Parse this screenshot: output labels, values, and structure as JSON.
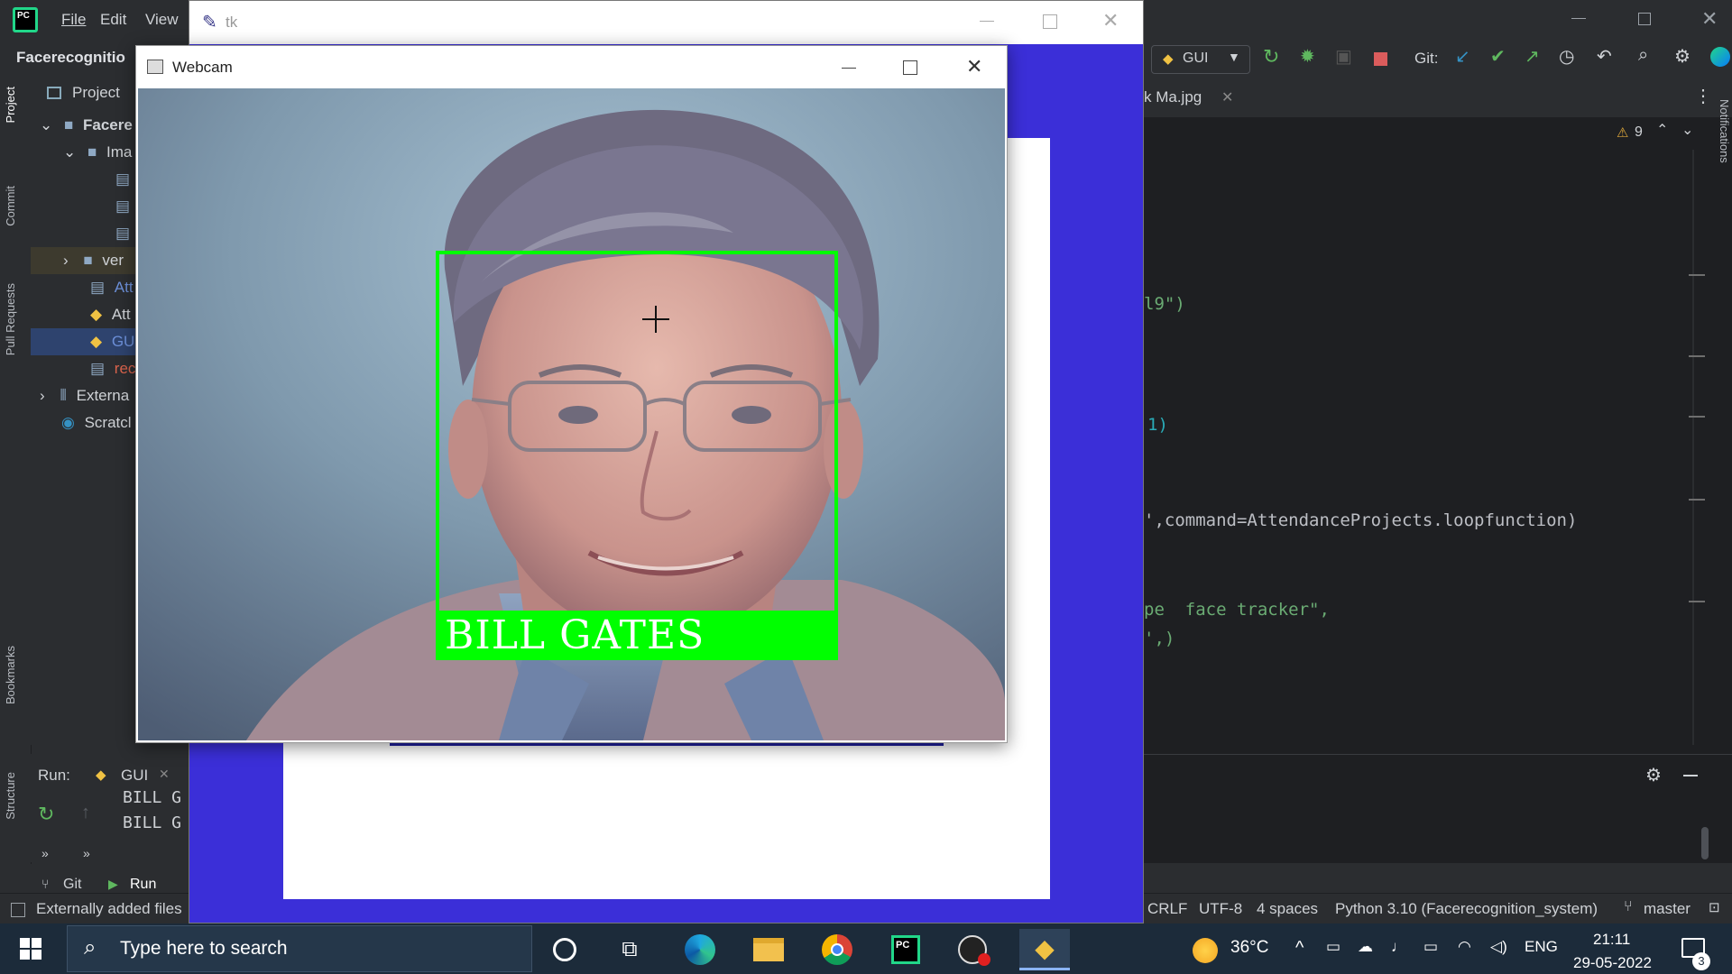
{
  "ide": {
    "menu": [
      "File",
      "Edit",
      "View"
    ],
    "project_name": "Facerecognitio",
    "run_config": "GUI",
    "git_label": "Git:",
    "project_tab": "Project",
    "tree": [
      {
        "label": "Facere",
        "kind": "folder"
      },
      {
        "label": "Ima",
        "kind": "folder"
      },
      {
        "label": "",
        "kind": "file"
      },
      {
        "label": "",
        "kind": "file"
      },
      {
        "label": "",
        "kind": "file"
      },
      {
        "label": "ver",
        "kind": "folder"
      },
      {
        "label": "Att",
        "kind": "file"
      },
      {
        "label": "Att",
        "kind": "python"
      },
      {
        "label": "GU",
        "kind": "python"
      },
      {
        "label": "rec",
        "kind": "file"
      },
      {
        "label": "Externa",
        "kind": "library"
      },
      {
        "label": "Scratcl",
        "kind": "scratch"
      }
    ],
    "side_tabs": [
      "Project",
      "Commit",
      "Pull Requests",
      "Bookmarks",
      "Structure"
    ],
    "right_side_tab": "Notifications",
    "editor_tab": "k Ma.jpg",
    "warning_count": "9",
    "code_lines": [
      {
        "text": "l9\")",
        "row": 0
      },
      {
        "text": "1)",
        "row": 1
      },
      {
        "text": "',command=AttendanceProjects.loopfunction)",
        "row": 2
      },
      {
        "text": "pe  face tracker\",",
        "row": 3
      },
      {
        "text": "',)",
        "row": 4
      }
    ],
    "run": {
      "label": "Run:",
      "tab": "GUI",
      "output": [
        "BILL G",
        "BILL G"
      ]
    },
    "bottom_tabs": [
      "Git",
      "Run"
    ],
    "status_left": "Externally added files",
    "status_right": {
      "line_sep": "CRLF",
      "encoding": "UTF-8",
      "indent": "4 spaces",
      "interpreter": "Python 3.10 (Facerecognition_system)",
      "branch": "master"
    }
  },
  "tk": {
    "title": "tk"
  },
  "webcam": {
    "title": "Webcam",
    "detected_name": "BILL GATES",
    "box_color": "#00ff00",
    "label_bg": "#00ff00"
  },
  "taskbar": {
    "search_placeholder": "Type here to search",
    "temperature": "36°C",
    "language": "ENG",
    "time": "21:11",
    "date": "29-05-2022",
    "notification_count": "3"
  }
}
